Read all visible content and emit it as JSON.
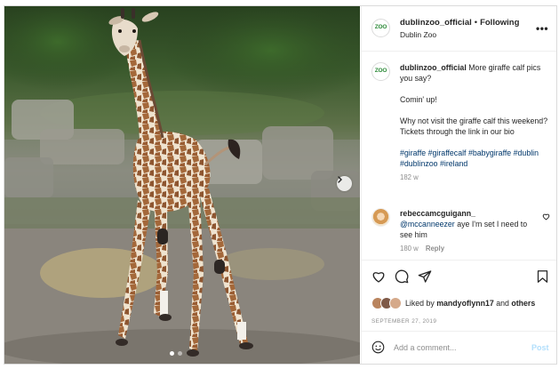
{
  "post": {
    "username": "dublinzoo_official",
    "separator": "•",
    "follow_label": "Following",
    "location": "Dublin Zoo",
    "avatar_logo": "ZOO",
    "more_icon": "more-dots-icon",
    "more_label": "•••"
  },
  "caption": {
    "username": "dublinzoo_official",
    "text1": "More giraffe calf pics you say?",
    "text2": "Comin' up!",
    "text3": "Why not visit the giraffe calf this weekend? Tickets through the link in our bio",
    "hashtags": "#giraffe #giraffecalf #babygiraffe #dublin #dublinzoo #ireland",
    "age": "182 w"
  },
  "comment": {
    "username": "rebeccamcguigann_",
    "mention": "@mccanneezer",
    "text": "aye I'm set I need to see him",
    "age": "180 w",
    "reply_label": "Reply"
  },
  "actions": {
    "icons": [
      "heart-icon",
      "comment-icon",
      "share-icon",
      "bookmark-icon"
    ]
  },
  "likes": {
    "prefix": "Liked by",
    "user": "mandyoflynn17",
    "and": "and",
    "others": "others"
  },
  "date": "SEPTEMBER 27, 2019",
  "add_comment": {
    "placeholder": "Add a comment...",
    "post_label": "Post"
  },
  "colors": {
    "link_blue": "#00376b",
    "post_button": "#b2dffc",
    "zoo_green": "#2e8b3a"
  },
  "carousel": {
    "current": 1,
    "total": 2
  }
}
